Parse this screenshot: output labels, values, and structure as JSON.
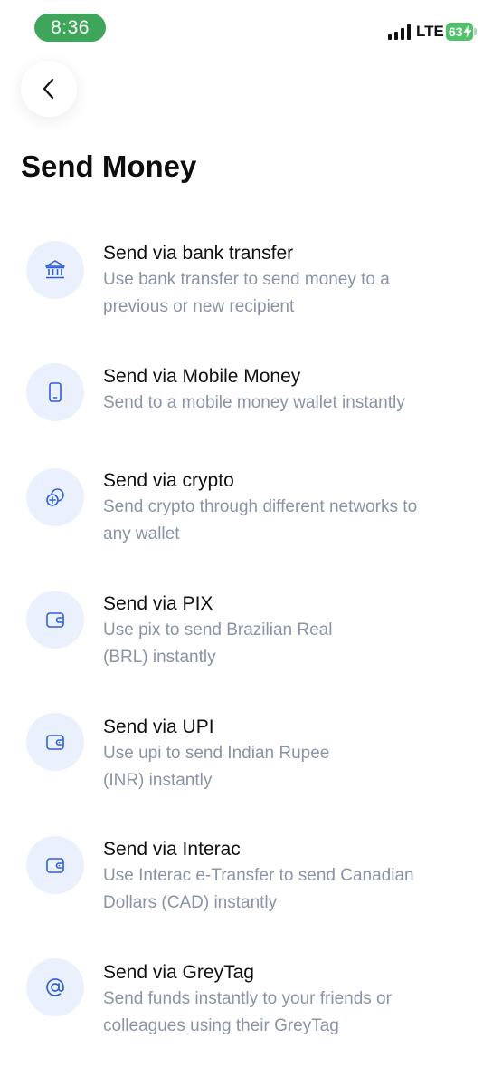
{
  "status_bar": {
    "time": "8:36",
    "network": "LTE",
    "battery": "63",
    "icons": [
      "signal-icon",
      "bolt-icon"
    ],
    "colors": {
      "time_pill": "#3ea55a",
      "battery": "#4fc26b"
    }
  },
  "header": {
    "back_icon": "chevron-left-icon",
    "title": "Send Money"
  },
  "options": [
    {
      "icon": "bank-icon",
      "title": "Send via bank transfer",
      "line1": "Use bank transfer to send money to a",
      "line2": "previous or new recipient"
    },
    {
      "icon": "mobile-phone-icon",
      "title": "Send via Mobile Money",
      "line1": "Send to a mobile money wallet instantly",
      "line2": ""
    },
    {
      "icon": "crypto-icon",
      "title": "Send via crypto",
      "line1": "Send crypto through different networks to",
      "line2": "any wallet"
    },
    {
      "icon": "wallet-icon",
      "title": "Send via PIX",
      "line1": "Use pix to send Brazilian Real",
      "line2": "(BRL) instantly"
    },
    {
      "icon": "wallet-icon",
      "title": "Send via UPI",
      "line1": "Use upi to send Indian Rupee",
      "line2": "(INR) instantly"
    },
    {
      "icon": "wallet-icon",
      "title": "Send via Interac",
      "line1": "Use Interac e-Transfer to send Canadian",
      "line2": "Dollars (CAD) instantly"
    },
    {
      "icon": "at-sign-icon",
      "title": "Send via GreyTag",
      "line1": "Send funds instantly to your friends or",
      "line2": "colleagues using their GreyTag"
    }
  ],
  "colors": {
    "icon_background": "#eaf1fc",
    "icon_accent": "#2f5fd8",
    "description_text": "#8a94a6"
  }
}
